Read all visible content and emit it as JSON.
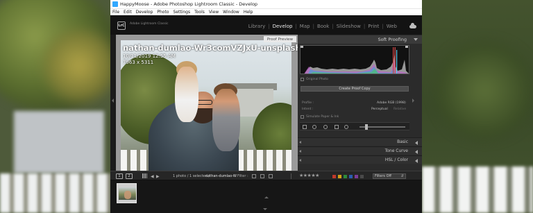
{
  "window": {
    "title": "HappyMoose - Adobe Photoshop Lightroom Classic - Develop",
    "menu": [
      "File",
      "Edit",
      "Develop",
      "Photo",
      "Settings",
      "Tools",
      "View",
      "Window",
      "Help"
    ]
  },
  "identity_plate": {
    "logo": "LrC",
    "name": "Adobe Lightroom Classic"
  },
  "modules": [
    "Library",
    "Develop",
    "Map",
    "Book",
    "Slideshow",
    "Print",
    "Web"
  ],
  "active_module": "Develop",
  "viewer": {
    "proof_preview_label": "Proof Preview",
    "filename": "nathan-dumlao-Wr3comVZJxU-unsplash.jpg",
    "date": "10/11/2019 12:55 AM",
    "dimensions": "7963 x 5311"
  },
  "right_panel": {
    "soft_proofing": {
      "title": "Soft Proofing",
      "original_photo_label": "Original Photo",
      "create_proof_copy": "Create Proof Copy",
      "profile_label": "Profile :",
      "profile_value": "Adobe RGB (1998)",
      "intent_label": "Intent :",
      "intent_perceptual": "Perceptual",
      "intent_relative": "Relative",
      "simulate_paper_label": "Simulate Paper & Ink"
    },
    "panels": [
      "Basic",
      "Tone Curve",
      "HSL / Color"
    ]
  },
  "filmstrip_bar": {
    "page_1": "1",
    "page_2": "2",
    "status": "1 photo / 1 selected /",
    "current_file": "nathan-dumlao-W",
    "filter_label": "Filter :",
    "filters_off": "Filters Off"
  },
  "colors": {
    "accent_swatches": [
      "#c0392b",
      "#d4a017",
      "#2e8b3a",
      "#2a5db0",
      "#7d3c98",
      "#4a4a4a"
    ]
  },
  "icons": {
    "cloud": "cloud-icon",
    "grid": "grid-icon"
  }
}
